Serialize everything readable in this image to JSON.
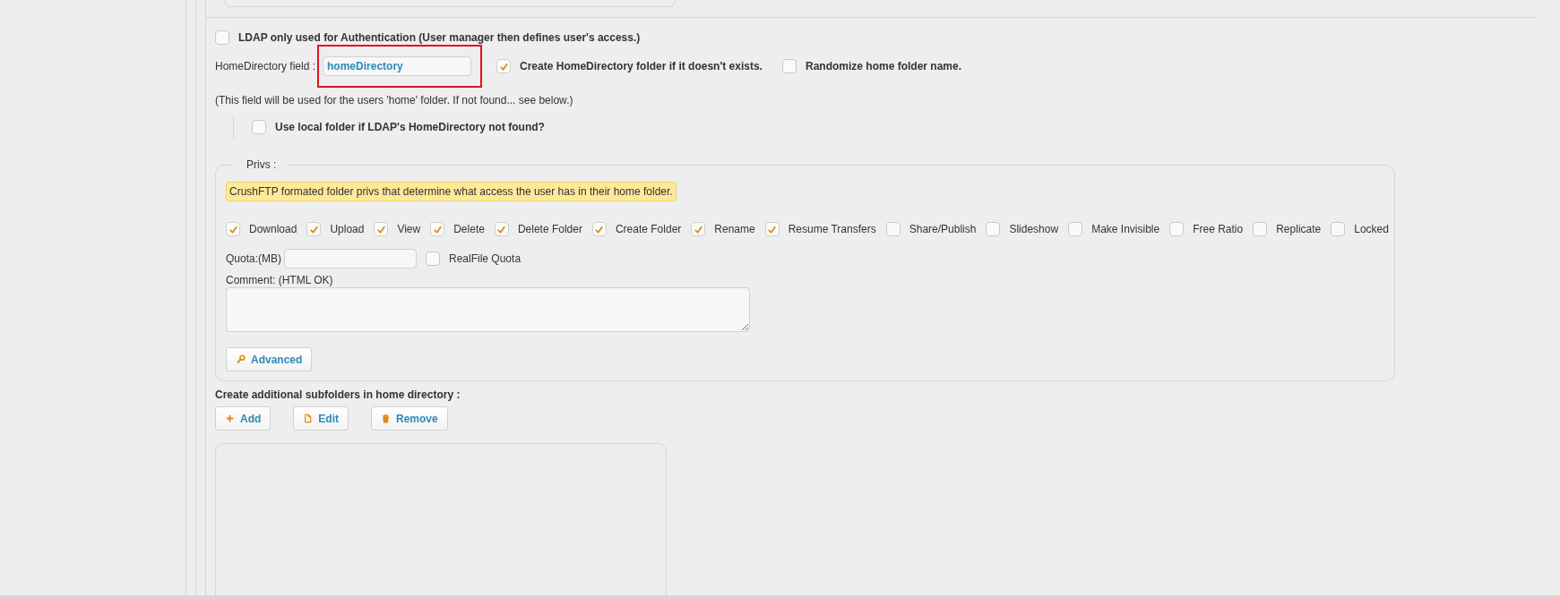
{
  "ldap_auth_only": {
    "label": "LDAP only used for Authentication (User manager then defines user's access.)",
    "checked": false
  },
  "home_directory": {
    "label": "HomeDirectory field :",
    "value": "homeDirectory",
    "highlighted": true,
    "options": [
      {
        "label": "Create HomeDirectory folder if it doesn't exists.",
        "checked": true
      },
      {
        "label": "Randomize home folder name.",
        "checked": false
      }
    ]
  },
  "note": "(This field will be used for the users 'home' folder. If not found... see below.)",
  "local_folder": {
    "label": "Use local folder if LDAP's HomeDirectory not found?",
    "checked": false
  },
  "privs": {
    "legend": "Privs :",
    "hint": "CrushFTP formated folder privs that determine what access the user has in their home folder.",
    "permissions": [
      {
        "label": "Download",
        "checked": true
      },
      {
        "label": "Upload",
        "checked": true
      },
      {
        "label": "View",
        "checked": true
      },
      {
        "label": "Delete",
        "checked": true
      },
      {
        "label": "Delete Folder",
        "checked": true
      },
      {
        "label": "Create Folder",
        "checked": true
      },
      {
        "label": "Rename",
        "checked": true
      },
      {
        "label": "Resume Transfers",
        "checked": true
      },
      {
        "label": "Share/Publish",
        "checked": false
      },
      {
        "label": "Slideshow",
        "checked": false
      },
      {
        "label": "Make Invisible",
        "checked": false
      },
      {
        "label": "Free Ratio",
        "checked": false
      },
      {
        "label": "Replicate",
        "checked": false
      },
      {
        "label": "Locked",
        "checked": false
      }
    ],
    "quota_label": "Quota:(MB)",
    "realfile_quota": {
      "label": "RealFile Quota",
      "checked": false
    },
    "comment_label": "Comment: (HTML OK)",
    "advanced_button": "Advanced"
  },
  "subfolders": {
    "title": "Create additional subfolders in home directory :",
    "buttons": [
      {
        "label": "Add",
        "kind": "add"
      },
      {
        "label": "Edit",
        "kind": "edit"
      },
      {
        "label": "Remove",
        "kind": "remove"
      }
    ]
  }
}
